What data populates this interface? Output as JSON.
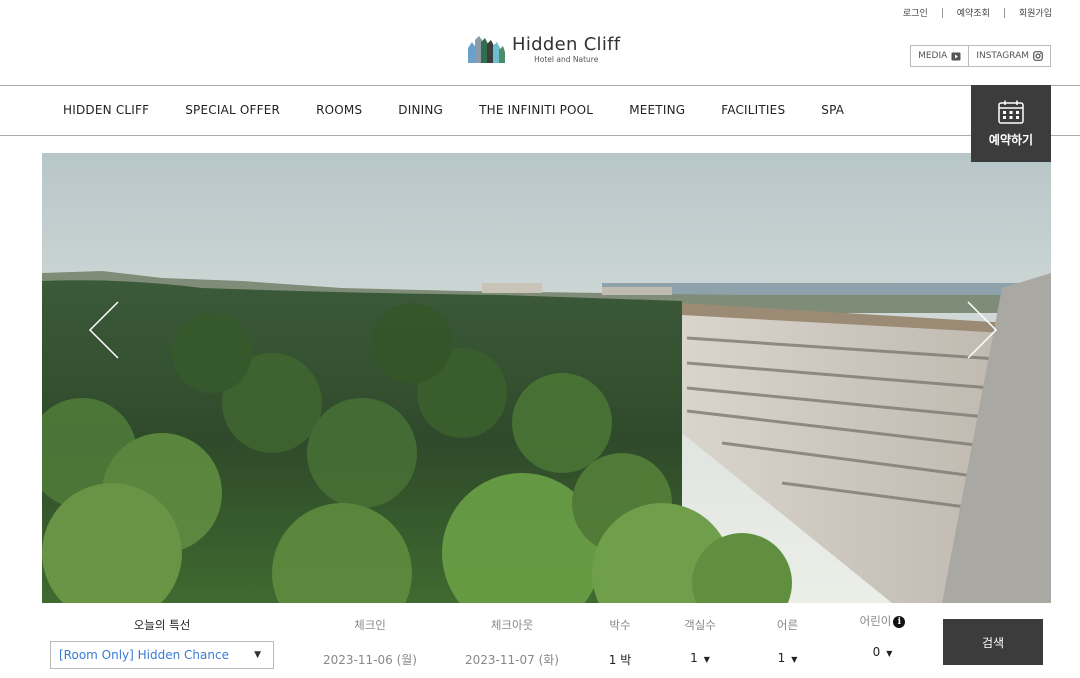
{
  "util_links": {
    "login": "로그인",
    "reservation_check": "예약조회",
    "signup": "회원가입"
  },
  "logo": {
    "name": "Hidden Cliff",
    "tagline": "Hotel and Nature"
  },
  "social": {
    "media": "MEDIA",
    "instagram": "INSTAGRAM"
  },
  "nav": {
    "items": [
      "HIDDEN CLIFF",
      "SPECIAL OFFER",
      "ROOMS",
      "DINING",
      "THE INFINITI POOL",
      "MEETING",
      "FACILITIES",
      "SPA"
    ]
  },
  "book_button": {
    "label": "예약하기",
    "icon": "calendar-icon"
  },
  "hero": {
    "icons": {
      "prev": "chevron-left-icon",
      "next": "chevron-right-icon"
    }
  },
  "booking": {
    "offer": {
      "label": "오늘의 특선",
      "value": "[Room Only] Hidden Chance"
    },
    "checkin": {
      "label": "체크인",
      "value": "2023-11-06 (월)"
    },
    "checkout": {
      "label": "체크아웃",
      "value": "2023-11-07 (화)"
    },
    "nights": {
      "label": "박수",
      "value": "1 박"
    },
    "rooms": {
      "label": "객실수",
      "value": "1"
    },
    "adults": {
      "label": "어른",
      "value": "1"
    },
    "children": {
      "label": "어린이",
      "value": "0"
    },
    "search_label": "검색"
  },
  "colors": {
    "dark_button": "#3c3c3c",
    "link_blue": "#3a7bd5"
  }
}
